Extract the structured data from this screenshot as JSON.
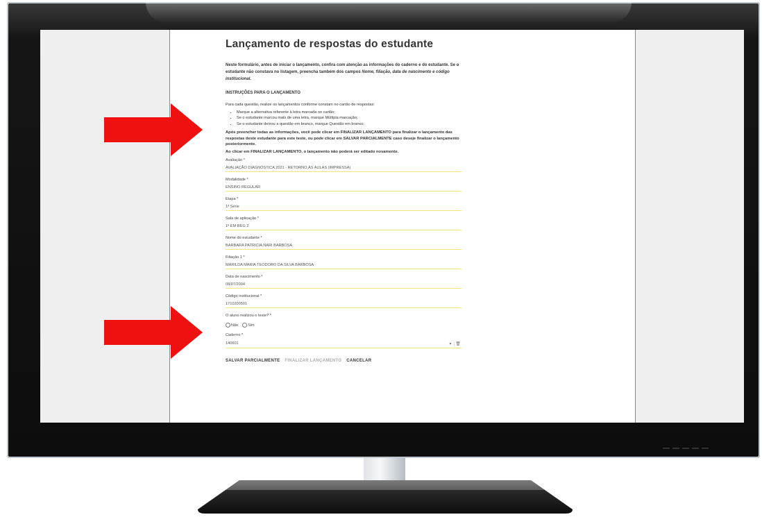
{
  "form": {
    "title": "Lançamento de respostas do estudante",
    "intro_text": "Neste formulário, antes de iniciar o lançamento, confira com atenção as informações do caderno e do estudante. Se o estudante não constava no listagem, preencha também dos campos",
    "intro_italic": "Nome, filiação, data de nascimento e código institucional.",
    "instructions_heading": "INSTRUÇÕES PARA O LANÇAMENTO",
    "instructions_lead": "Para cada questão, realize os lançamentos conforme constam no cartão de respostas:",
    "instructions_items": [
      "Marque a alternativa referente à letra marcada no cartão;",
      "Se o estudante marcou mais de uma letra, marque Múltipla marcação;",
      "Se o estudante deixou a questão em branco, marque Questão em branco."
    ],
    "finalize_text": "Após preencher todas as informações, você pode clicar em FINALIZAR LANÇAMENTO para finalizar o lançamento das respostas deste estudante para este teste, ou pode clicar em SALVAR PARCIALMENTE caso deseje finalizar o lançamento posteriormente.",
    "warning_text": "Ao clicar em FINALIZAR LANÇAMENTO, o lançamento não poderá ser editado novamente.",
    "fields": {
      "avaliacao": {
        "label": "Avaliação *",
        "value": "AVALIAÇÃO DIAGNÓSTICA 2021 - RETORNO ÀS AULAS (IMPRESSA)"
      },
      "modalidade": {
        "label": "Modalidade *",
        "value": "ENSINO REGULAR"
      },
      "etapa": {
        "label": "Etapa *",
        "value": "1ª Série"
      },
      "sala": {
        "label": "Sala de aplicação *",
        "value": "1ª EM REG 2"
      },
      "nome": {
        "label": "Nome do estudante *",
        "value": "BARBARA PATRICIA NARI BARBOSA"
      },
      "filiacao": {
        "label": "Filiação 1 *",
        "value": "MARILDA MARIA TEODORO DA SILVA BARBOSA"
      },
      "nascimento": {
        "label": "Data de nascimento *",
        "value": "08/07/2004"
      },
      "codigo": {
        "label": "Código institucional *",
        "value": "1710200501"
      }
    },
    "realizou": {
      "label": "O aluno realizou o teste? *",
      "options": [
        "Não",
        "Sim"
      ]
    },
    "caderno": {
      "label": "Caderno *",
      "value": "140601"
    },
    "actions": {
      "save": "SALVAR PARCIALMENTE",
      "finalize": "FINALIZAR LANÇAMENTO",
      "cancel": "CANCELAR"
    }
  },
  "colors": {
    "arrow": "#ef1010",
    "field_underline": "#f2e775",
    "screen_background": "#efefef",
    "bezel": "#151515"
  }
}
